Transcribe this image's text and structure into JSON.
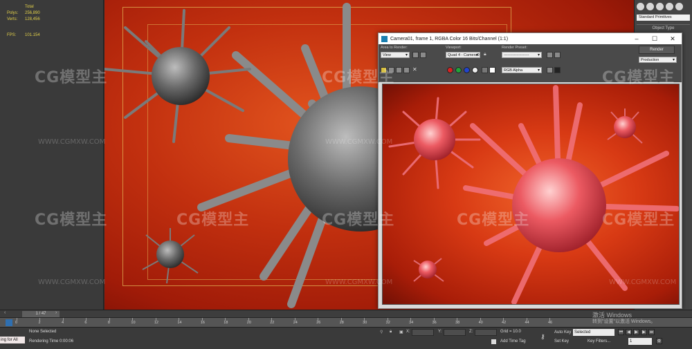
{
  "stats": {
    "total_label": "Total",
    "polys_label": "Polys:",
    "polys_value": "256,890",
    "verts_label": "Verts:",
    "verts_value": "128,456",
    "fps_label": "FPS:",
    "fps_value": "101.154"
  },
  "command_panel": {
    "category_select": "Standard Primitives",
    "object_type_header": "Object Type"
  },
  "render_window": {
    "title": "Camera01, frame 1, RGBA Color 16 Bits/Channel (1:1)",
    "area_label": "Area to Render:",
    "area_value": "View",
    "viewport_label": "Viewport:",
    "viewport_value": "Quad 4 - Camera0",
    "preset_label": "Render Preset:",
    "preset_value": "--------------------",
    "render_button": "Render",
    "production_value": "Production",
    "channel_value": "RGB Alpha"
  },
  "timeline": {
    "frame_display": "1 / 47",
    "ticks": [
      "0",
      "2",
      "4",
      "6",
      "8",
      "10",
      "12",
      "14",
      "16",
      "18",
      "20",
      "22",
      "24",
      "26",
      "28",
      "30",
      "32",
      "34",
      "36",
      "38",
      "40",
      "42",
      "44",
      "46"
    ]
  },
  "status": {
    "maxscript": "ing for All",
    "selection": "None Selected",
    "rendering_time": "Rendering Time  0:00:06",
    "x_label": "X:",
    "y_label": "Y:",
    "z_label": "Z:",
    "grid": "Grid = 10.0",
    "add_time_tag": "Add Time Tag",
    "auto_key": "Auto Key",
    "selected_value": "Selected",
    "set_key": "Set Key",
    "key_filters": "Key Filters...",
    "frame_field": "1"
  },
  "watermarks": {
    "brand": "CG模型主",
    "url": "WWW.CGMXW.COM"
  },
  "windows_activation": {
    "title": "激活 Windows",
    "subtitle": "转到\"设置\"以激活 Windows。"
  },
  "colors": {
    "viewport_bg": "#c2300f",
    "render_bg": "#d83a14",
    "virus_gray": "#5a5a5a",
    "virus_red": "#e0505a",
    "stats_yellow": "#e4d24a"
  }
}
